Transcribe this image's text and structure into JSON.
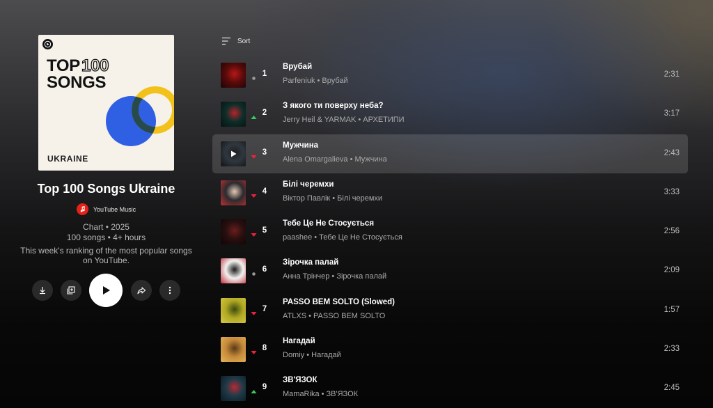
{
  "playlist": {
    "cover": {
      "title_part1": "TOP",
      "title_part2": "100",
      "title_line2": "SONGS",
      "country": "UKRAINE",
      "colors": {
        "blue": "#2f5fe3",
        "yellow": "#f2c21b",
        "dark": "#111111"
      }
    },
    "title": "Top 100 Songs Ukraine",
    "owner": "YouTube Music",
    "meta_line1": "Chart • 2025",
    "meta_line2": "100 songs • 4+ hours",
    "description": "This week's ranking of the most popular songs on YouTube."
  },
  "actions": [
    {
      "name": "download-button",
      "icon": "download-icon"
    },
    {
      "name": "save-to-library-button",
      "icon": "library-add-icon"
    },
    {
      "name": "play-button",
      "icon": "play-icon"
    },
    {
      "name": "share-button",
      "icon": "share-icon"
    },
    {
      "name": "more-button",
      "icon": "more-vert-icon"
    }
  ],
  "sort": {
    "label": "Sort"
  },
  "trend_colors": {
    "up": "#3dc95f",
    "down": "#f0203a",
    "same": "#9a9a9a"
  },
  "tracks": [
    {
      "rank": "1",
      "trend": "same",
      "title": "Врубай",
      "subtitle": "Parfeniuk • Врубай",
      "duration": "2:31",
      "thumb": [
        "#5a0a0a",
        "#b51818",
        "#1a0505"
      ]
    },
    {
      "rank": "2",
      "trend": "up",
      "title": "З якого ти поверху неба?",
      "subtitle": "Jerry Heil & YARMAK • АРХЕТИПИ",
      "duration": "3:17",
      "thumb": [
        "#0d2e2a",
        "#b4242c",
        "#07120f"
      ]
    },
    {
      "rank": "3",
      "trend": "down",
      "title": "Мужчина",
      "subtitle": "Alena Omargalieva • Мужчина",
      "duration": "2:43",
      "thumb": [
        "#4b5560",
        "#2a3036",
        "#1a1e22"
      ]
    },
    {
      "rank": "4",
      "trend": "down",
      "title": "Білі черемхи",
      "subtitle": "Віктор Павлік • Білі черемхи",
      "duration": "3:33",
      "thumb": [
        "#2b2b2f",
        "#e3c7b3",
        "#c23030"
      ]
    },
    {
      "rank": "5",
      "trend": "down",
      "title": "Тебе Це Не Стосується",
      "subtitle": "paashee • Тебе Це Не Стосується",
      "duration": "2:56",
      "thumb": [
        "#2a0f0f",
        "#6a1d1d",
        "#0d0606"
      ]
    },
    {
      "rank": "6",
      "trend": "same",
      "title": "Зірочка палай",
      "subtitle": "Анна Трінчер • Зірочка палай",
      "duration": "2:09",
      "thumb": [
        "#f1f1ee",
        "#1a1a1a",
        "#c22d3c"
      ]
    },
    {
      "rank": "7",
      "trend": "down",
      "title": "PASSO BEM SOLTO (Slowed)",
      "subtitle": "ATLXS • PASSO BEM SOLTO",
      "duration": "1:57",
      "thumb": [
        "#b0a822",
        "#3a4a12",
        "#d9c84a"
      ]
    },
    {
      "rank": "8",
      "trend": "down",
      "title": "Нагадай",
      "subtitle": "Domiy • Нагадай",
      "duration": "2:33",
      "thumb": [
        "#c58a3a",
        "#5a3a18",
        "#e6b45a"
      ]
    },
    {
      "rank": "9",
      "trend": "up",
      "title": "ЗВ'ЯЗОК",
      "subtitle": "MamaRika • ЗВ'ЯЗОК",
      "duration": "2:45",
      "thumb": [
        "#1e3a48",
        "#b52b34",
        "#0c1a22"
      ]
    }
  ],
  "active_track_index": 2
}
